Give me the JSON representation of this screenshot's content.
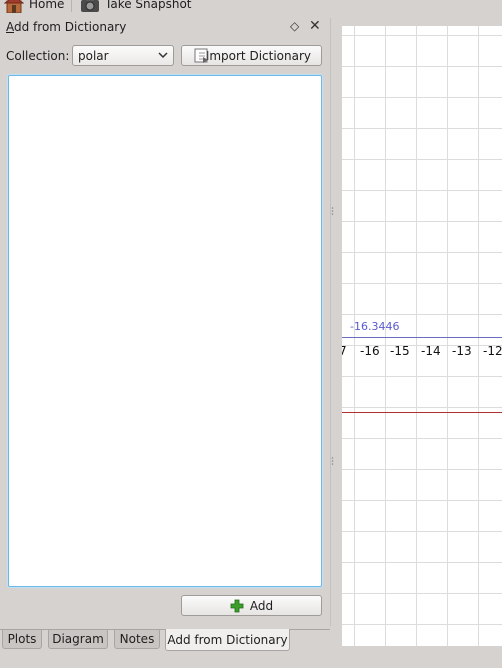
{
  "toolbar": {
    "home_label": "Home",
    "snapshot_label": "Take Snapshot",
    "home_icon": "home-icon",
    "snapshot_icon": "camera-icon"
  },
  "dock": {
    "title": "Add from Dictionary",
    "float_glyph": "◇",
    "close_glyph": "✕",
    "collection_label": "Collection:",
    "collection_value": "polar",
    "import_label": "Import Dictionary",
    "add_label": "Add"
  },
  "tabs": [
    {
      "label": "Plots",
      "active": false
    },
    {
      "label": "Diagram",
      "active": false
    },
    {
      "label": "Notes",
      "active": false
    },
    {
      "label": "Add from Dictionary",
      "active": true
    }
  ],
  "plot": {
    "readout": "-16.3446",
    "tick_labels": [
      "7",
      "-16",
      "-15",
      "-14",
      "-13",
      "-12"
    ]
  },
  "colors": {
    "accent_focus": "#6fb8e6",
    "axis": "#6b6bc4",
    "curve": "#b03030",
    "add_icon": "#3aa02a"
  }
}
